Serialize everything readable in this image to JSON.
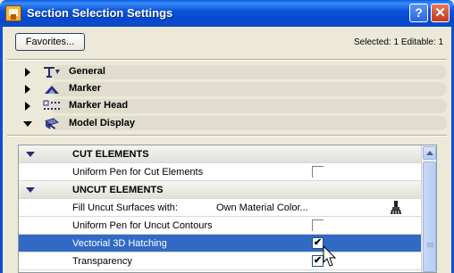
{
  "window": {
    "title": "Section Selection Settings",
    "help_label": "?",
    "close_label": "✕"
  },
  "toolbar": {
    "favorites_label": "Favorites...",
    "selection_info": "Selected: 1 Editable: 1"
  },
  "sections": [
    {
      "label": "General",
      "icon": "general-icon",
      "expanded": false
    },
    {
      "label": "Marker",
      "icon": "marker-icon",
      "expanded": false
    },
    {
      "label": "Marker Head",
      "icon": "marker-head-icon",
      "expanded": false
    },
    {
      "label": "Model Display",
      "icon": "model-display-icon",
      "expanded": true
    }
  ],
  "model_display": {
    "cut_header": "CUT ELEMENTS",
    "uncut_header": "UNCUT ELEMENTS",
    "rows": [
      {
        "label": "Uniform Pen for Cut Elements",
        "checked": false
      },
      {
        "label": "Fill Uncut Surfaces with:",
        "value": "Own Material Color...",
        "icon": "brush-icon"
      },
      {
        "label": "Uniform Pen for Uncut Contours",
        "checked": false
      },
      {
        "label": "Vectorial 3D Hatching",
        "checked": true,
        "selected": true,
        "check_glyph": "✔"
      },
      {
        "label": "Transparency",
        "checked": true,
        "check_glyph": "✔"
      }
    ]
  },
  "colors": {
    "titlebar": "#0b54da",
    "selection": "#316ac5",
    "dialog_bg": "#ece9d8"
  }
}
